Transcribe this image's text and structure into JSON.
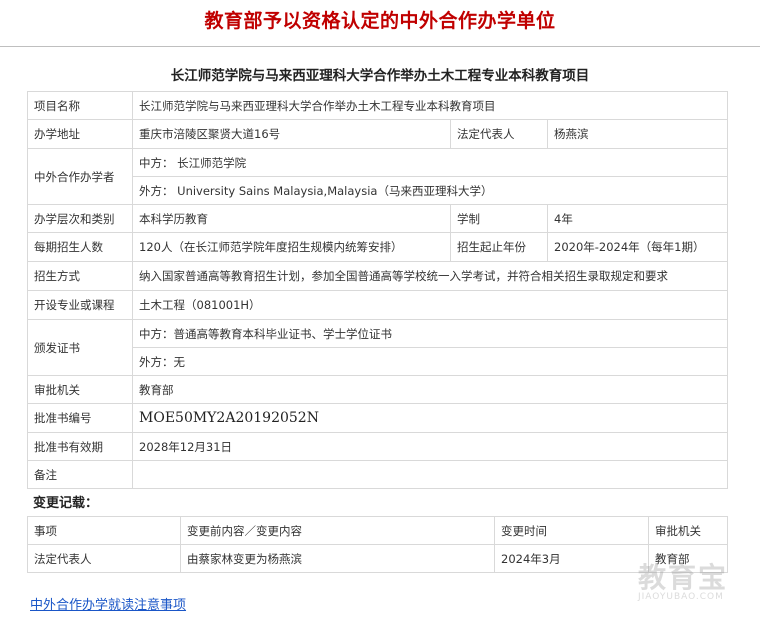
{
  "banner": {
    "title": "教育部予以资格认定的中外合作办学单位"
  },
  "project": {
    "title": "长江师范学院与马来西亚理科大学合作举办土木工程专业本科教育项目"
  },
  "info": {
    "project_name_label": "项目名称",
    "project_name_value": "长江师范学院与马来西亚理科大学合作举办土木工程专业本科教育项目",
    "address_label": "办学地址",
    "address_value": "重庆市涪陵区聚贤大道16号",
    "legal_rep_label": "法定代表人",
    "legal_rep_value": "杨燕滨",
    "partners_label": "中外合作办学者",
    "partner_cn": "中方：  长江师范学院",
    "partner_foreign": "外方：  University Sains Malaysia,Malaysia（马来西亚理科大学）",
    "level_label": "办学层次和类别",
    "level_value": "本科学历教育",
    "duration_label": "学制",
    "duration_value": "4年",
    "enroll_label": "每期招生人数",
    "enroll_value": "120人（在长江师范学院年度招生规模内统筹安排）",
    "enroll_years_label": "招生起止年份",
    "enroll_years_value": "2020年-2024年（每年1期）",
    "admission_label": "招生方式",
    "admission_value": "纳入国家普通高等教育招生计划，参加全国普通高等学校统一入学考试，并符合相关招生录取规定和要求",
    "major_label": "开设专业或课程",
    "major_value": "土木工程（081001H）",
    "cert_label": "颁发证书",
    "cert_cn": "中方：普通高等教育本科毕业证书、学士学位证书",
    "cert_foreign": "外方：无",
    "authority_label": "审批机关",
    "authority_value": "教育部",
    "approval_no_label": "批准书编号",
    "approval_no_value": "MOE50MY2A20192052N",
    "valid_label": "批准书有效期",
    "valid_value": "2028年12月31日",
    "remark_label": "备注",
    "remark_value": ""
  },
  "changes": {
    "heading": "变更记载：",
    "headers": [
      "事项",
      "变更前内容／变更内容",
      "变更时间",
      "审批机关"
    ],
    "rows": [
      [
        "法定代表人",
        "由蔡家林变更为杨燕滨",
        "2024年3月",
        "教育部"
      ]
    ]
  },
  "footer": {
    "link": "中外合作办学就读注意事项"
  },
  "watermark": {
    "main": "教育宝",
    "sub": "JIAOYUBAO.COM"
  }
}
